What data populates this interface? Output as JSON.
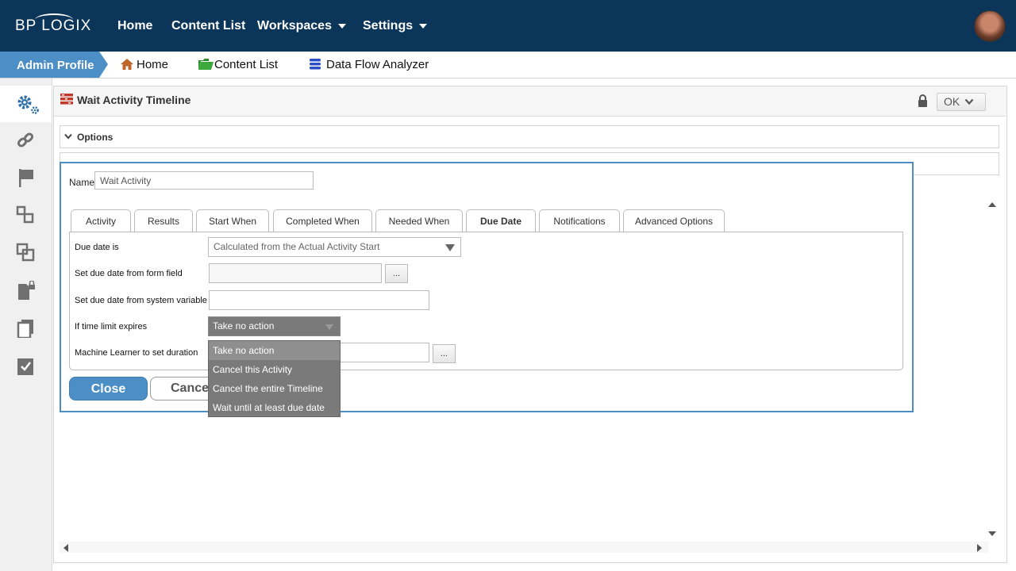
{
  "topnav": {
    "brand": "BP LOGIX",
    "links": {
      "home": "Home",
      "content_list": "Content List",
      "workspaces": "Workspaces",
      "settings": "Settings"
    }
  },
  "breadcrumb": {
    "profile": "Admin Profile",
    "home": "Home",
    "content_list": "Content List",
    "data_flow": "Data Flow Analyzer"
  },
  "panel": {
    "title": "Wait Activity Timeline",
    "ok_label": "OK",
    "options_label": "Options"
  },
  "dialog": {
    "name_label": "Name",
    "name_value": "Wait Activity",
    "tabs": [
      "Activity",
      "Results",
      "Start When",
      "Completed When",
      "Needed When",
      "Due Date",
      "Notifications",
      "Advanced Options"
    ],
    "fields": {
      "due_date_label": "Due date is",
      "due_date_value": "Calculated from the Actual Activity Start",
      "form_field_label": "Set due date from form field",
      "system_var_label": "Set due date from system variable",
      "time_limit_label": "If time limit expires",
      "time_limit_value": "Take no action",
      "ml_label": "Machine Learner to set duration",
      "dots": "..."
    },
    "time_limit_options": [
      "Take no action",
      "Cancel this Activity",
      "Cancel the entire Timeline",
      "Wait until at least due date"
    ],
    "close_label": "Close",
    "cancel_label": "Cancel"
  },
  "colors": {
    "nav_bg": "#0b3559",
    "accent": "#4c8fc7",
    "dropdown_bg": "#7a7a7a"
  },
  "icons": {
    "rail": [
      "gears-icon",
      "link-icon",
      "flag-icon",
      "steps-icon",
      "copy-icon",
      "locked-document-icon",
      "documents-icon",
      "checklist-icon"
    ]
  }
}
